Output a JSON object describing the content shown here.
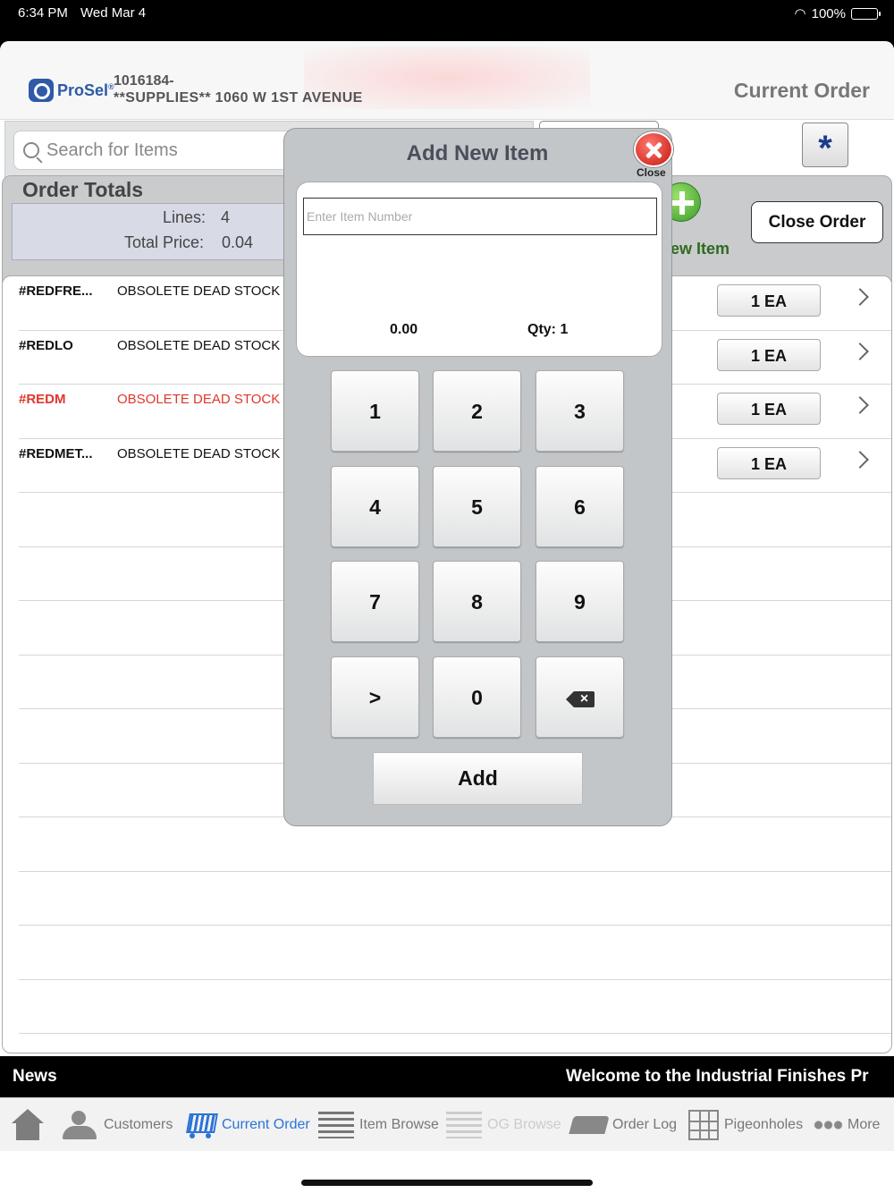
{
  "status_bar": {
    "time": "6:34 PM",
    "date": "Wed Mar 4",
    "battery": "100%"
  },
  "header": {
    "brand": "ProSel",
    "customer_id": "1016184-",
    "customer_name": "**SUPPLIES** 1060 W 1ST AVENUE",
    "title": "Current Order"
  },
  "search": {
    "placeholder": "Search for Items",
    "value": ""
  },
  "star_label": "*",
  "totals": {
    "title": "Order Totals",
    "lines_label": "Lines:",
    "lines_value": "4",
    "price_label": "Total Price:",
    "price_value": "0.04"
  },
  "new_item_label": "ew Item",
  "close_order_label": "Close Order",
  "order_lines": [
    {
      "number": "#REDFRE...",
      "description": "OBSOLETE DEAD STOCK",
      "qty": "1 EA"
    },
    {
      "number": "#REDLO",
      "description": "OBSOLETE DEAD STOCK",
      "qty": "1 EA"
    },
    {
      "number": "#REDM",
      "description": "OBSOLETE DEAD STOCK",
      "qty": "1 EA"
    },
    {
      "number": "#REDMET...",
      "description": "OBSOLETE DEAD STOCK",
      "qty": "1 EA"
    }
  ],
  "colors": {
    "accent": "#2a74d6",
    "error_red": "#e0362c",
    "brand_blue": "#2e5aa8",
    "add_green": "#3a9b2a"
  },
  "news": {
    "label": "News",
    "ticker": "Welcome to the Industrial Finishes Pr"
  },
  "tabs": [
    {
      "label": "",
      "icon": "home-icon"
    },
    {
      "label": "Customers",
      "icon": "customers-icon"
    },
    {
      "label": "Current Order",
      "icon": "cart-icon"
    },
    {
      "label": "Item Browse",
      "icon": "item-browse-icon"
    },
    {
      "label": "OG Browse",
      "icon": "og-browse-icon"
    },
    {
      "label": "Order Log",
      "icon": "order-log-icon"
    },
    {
      "label": "Pigeonholes",
      "icon": "pigeonholes-icon"
    },
    {
      "label": "More",
      "icon": "more-icon"
    }
  ],
  "modal": {
    "title": "Add New Item",
    "close_label": "Close",
    "input_placeholder": "Enter Item Number",
    "input_value": "",
    "price": "0.00",
    "qty": "Qty: 1",
    "keys": [
      "1",
      "2",
      "3",
      "4",
      "5",
      "6",
      "7",
      "8",
      "9",
      ">",
      "0"
    ],
    "add_label": "Add"
  }
}
